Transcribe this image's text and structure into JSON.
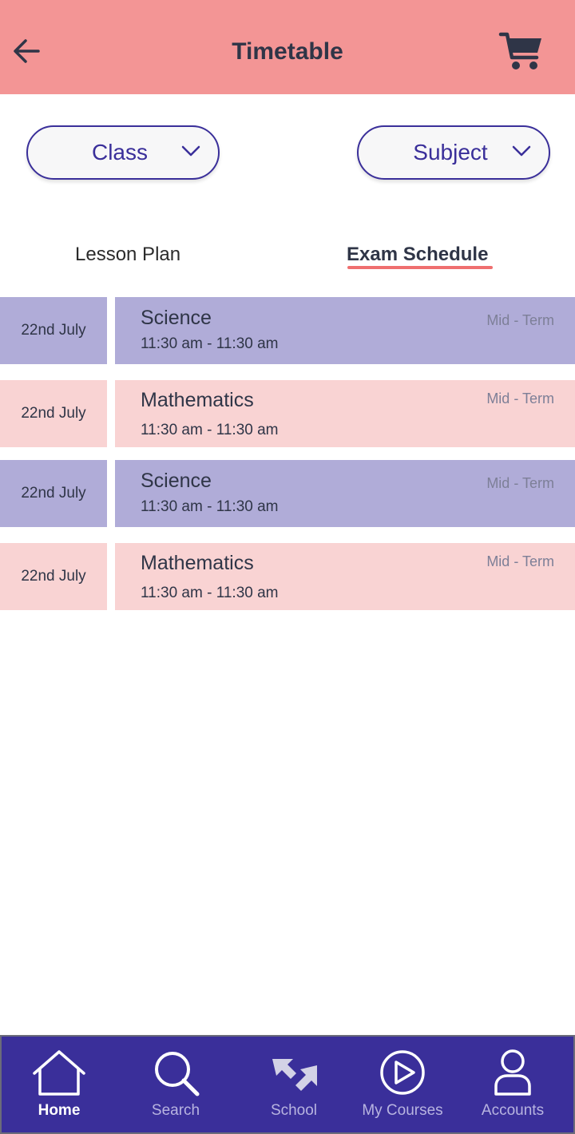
{
  "header": {
    "title": "Timetable",
    "back_icon": "arrow-left-icon",
    "cart_icon": "cart-icon",
    "background_color": "#f39595"
  },
  "filters": {
    "class_label": "Class",
    "subject_label": "Subject"
  },
  "tabs": [
    {
      "label": "Lesson Plan",
      "active": false
    },
    {
      "label": "Exam Schedule",
      "active": true
    }
  ],
  "schedule": [
    {
      "date": "22nd July",
      "subject": "Science",
      "time": "11:30 am - 11:30 am",
      "term": "Mid - Term",
      "color": "#b0acd8"
    },
    {
      "date": "22nd July",
      "subject": "Mathematics",
      "time": "11:30 am - 11:30 am",
      "term": "Mid - Term",
      "color": "#f9d3d3"
    },
    {
      "date": "22nd July",
      "subject": "Science",
      "time": "11:30 am - 11:30 am",
      "term": "Mid - Term",
      "color": "#b0acd8"
    },
    {
      "date": "22nd July",
      "subject": "Mathematics",
      "time": "11:30 am - 11:30 am",
      "term": "Mid - Term",
      "color": "#f9d3d3"
    }
  ],
  "bottom_nav": [
    {
      "label": "Home",
      "icon": "home-icon",
      "active": true
    },
    {
      "label": "Search",
      "icon": "search-icon",
      "active": false
    },
    {
      "label": "School",
      "icon": "school-icon",
      "active": false
    },
    {
      "label": "My Courses",
      "icon": "play-circle-icon",
      "active": false
    },
    {
      "label": "Accounts",
      "icon": "user-icon",
      "active": false
    }
  ],
  "colors": {
    "accent": "#3a2f9a",
    "tab_underline": "#ef6f6f"
  }
}
